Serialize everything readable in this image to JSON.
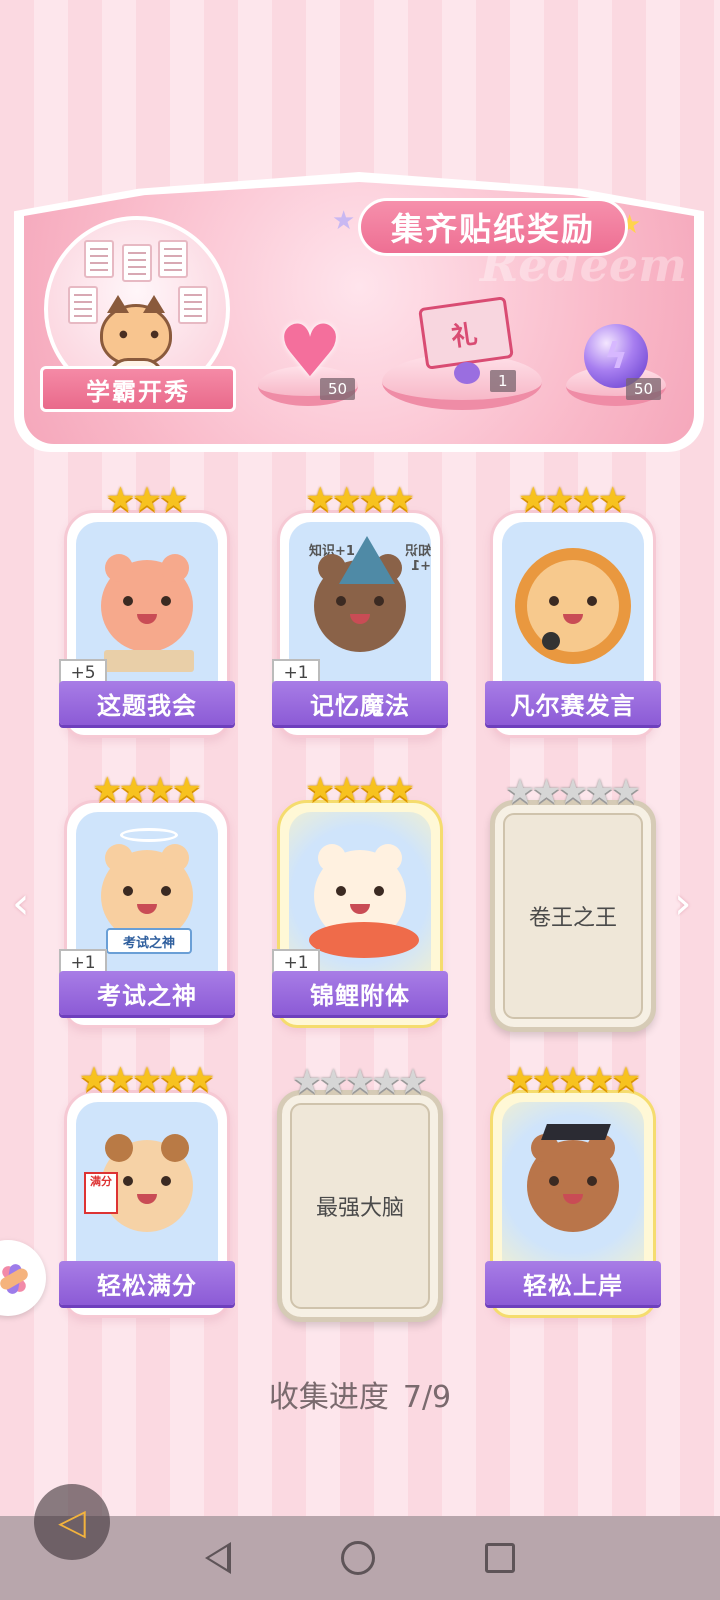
{
  "banner": {
    "title": "集齐贴纸奖励",
    "watermark": "Redeem",
    "theme_label": "学霸开秀",
    "rewards": [
      {
        "icon": "pink-heart-gem-icon",
        "count": "50"
      },
      {
        "icon": "gift-box-icon",
        "count": "1"
      },
      {
        "icon": "purple-lightning-orb-icon",
        "count": "50"
      }
    ]
  },
  "cards": [
    {
      "name": "这题我会",
      "stars": 3,
      "collected": true,
      "bonus": "+5",
      "mascot": "bear-at-desk"
    },
    {
      "name": "记忆魔法",
      "stars": 4,
      "collected": true,
      "bonus": "+1",
      "mascot": "otter-wizard",
      "props": [
        "知识+1",
        "知识+1"
      ]
    },
    {
      "name": "凡尔赛发言",
      "stars": 4,
      "collected": true,
      "bonus": "",
      "mascot": "lion-microphone"
    },
    {
      "name": "考试之神",
      "stars": 4,
      "collected": true,
      "bonus": "+1",
      "mascot": "angel-cat",
      "props": [
        "考试之神"
      ]
    },
    {
      "name": "锦鲤附体",
      "stars": 4,
      "collected": true,
      "bonus": "+1",
      "mascot": "bear-koi-fish",
      "gold": true
    },
    {
      "name": "卷王之王",
      "stars": 5,
      "collected": false
    },
    {
      "name": "轻松满分",
      "stars": 5,
      "collected": true,
      "bonus": "",
      "mascot": "puppy-full-marks",
      "props": [
        "满分"
      ]
    },
    {
      "name": "最强大脑",
      "stars": 5,
      "collected": false
    },
    {
      "name": "轻松上岸",
      "stars": 5,
      "collected": true,
      "bonus": "",
      "mascot": "squirrel-graduate",
      "gold": true
    }
  ],
  "progress": {
    "label": "收集进度",
    "value": "7/9"
  },
  "colors": {
    "accent_purple": "#8c5bd6",
    "star_gold": "#f7c21f",
    "banner_pink": "#ee6f93"
  }
}
